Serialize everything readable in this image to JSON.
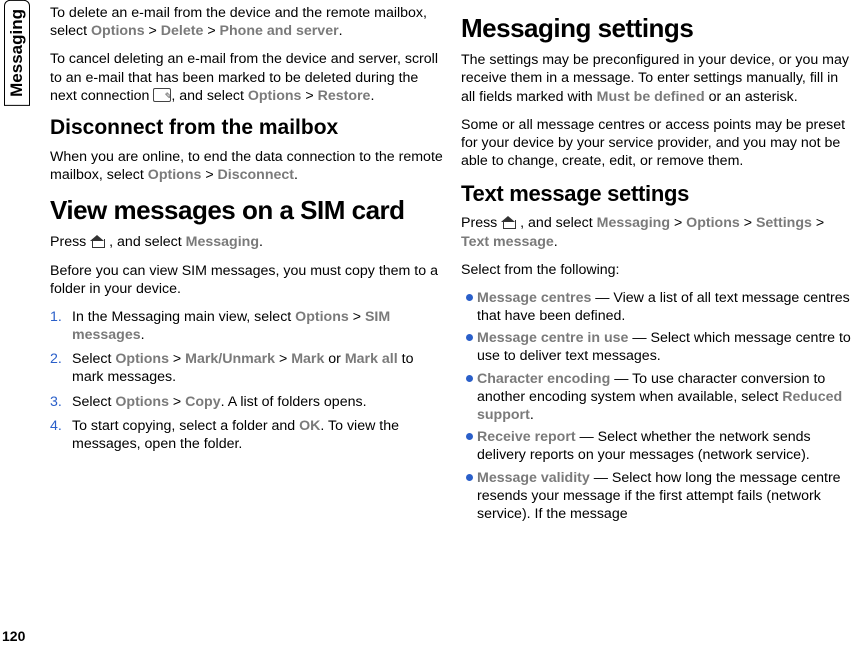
{
  "side_tab": "Messaging",
  "page_number": "120",
  "left": {
    "intro1_a": "To delete an e-mail from the device and the remote mailbox, select ",
    "intro1_opt": "Options",
    "intro1_gt1": " > ",
    "intro1_del": "Delete",
    "intro1_gt2": " > ",
    "intro1_ps": "Phone and server",
    "intro1_end": ".",
    "intro2_a": "To cancel deleting an e-mail from the device and server, scroll to an e-mail that has been marked to be deleted during the next connection ",
    "intro2_b": ", and select ",
    "intro2_opt": "Options",
    "intro2_gt": " > ",
    "intro2_rest": "Restore",
    "intro2_end": ".",
    "h_disconnect": "Disconnect from the mailbox",
    "disc_a": "When you are online, to end the data connection to the remote mailbox, select ",
    "disc_opt": "Options",
    "disc_gt": " > ",
    "disc_dc": "Disconnect",
    "disc_end": ".",
    "h_sim": "View messages on a SIM card",
    "sim_p1_a": "Press ",
    "sim_p1_b": " , and select ",
    "sim_p1_msg": "Messaging",
    "sim_p1_end": ".",
    "sim_p2": "Before you can view SIM messages, you must copy them to a folder in your device.",
    "steps": [
      {
        "n": "1.",
        "a": "In the Messaging main view, select ",
        "b": "Options",
        "c": " > ",
        "d": "SIM messages",
        "e": "."
      },
      {
        "n": "2.",
        "a": "Select ",
        "b": "Options",
        "c": " > ",
        "d": "Mark/Unmark",
        "e": " > ",
        "f": "Mark",
        "g": " or ",
        "h": "Mark all",
        "i": " to mark messages."
      },
      {
        "n": "3.",
        "a": "Select ",
        "b": "Options",
        "c": " > ",
        "d": "Copy",
        "e": ". A list of folders opens."
      },
      {
        "n": "4.",
        "a": "To start copying, select a folder and ",
        "b": "OK",
        "c": ". To view the messages, open the folder."
      }
    ]
  },
  "right": {
    "h_settings": "Messaging settings",
    "set_p1_a": "The settings may be preconfigured in your device, or you may receive them in a message. To enter settings manually, fill in all fields marked with ",
    "set_p1_b": "Must be defined",
    "set_p1_c": " or an asterisk.",
    "set_p2": "Some or all message centres or access points may be preset for your device by your service provider, and you may not be able to change, create, edit, or remove them.",
    "h_text": "Text message settings",
    "txt_a": "Press ",
    "txt_b": " , and select ",
    "txt_msg": "Messaging",
    "txt_gt1": " > ",
    "txt_opt": "Options",
    "txt_gt2": " > ",
    "txt_set": "Settings",
    "txt_gt3": " > ",
    "txt_tm": "Text message",
    "txt_end": ".",
    "select_from": "Select from the following:",
    "bullets": [
      {
        "b": "Message centres",
        "t": " — View a list of all text message centres that have been defined."
      },
      {
        "b": "Message centre in use",
        "t": "  — Select which message centre to use to deliver text messages."
      },
      {
        "b": "Character encoding",
        "t": " — To use character conversion to another encoding system when available, select ",
        "b2": "Reduced support",
        "t2": "."
      },
      {
        "b": "Receive report",
        "t": " — Select whether the network sends delivery reports on your messages (network service)."
      },
      {
        "b": "Message validity",
        "t": " — Select how long the message centre resends your message if the first attempt fails (network service). If the message"
      }
    ]
  }
}
